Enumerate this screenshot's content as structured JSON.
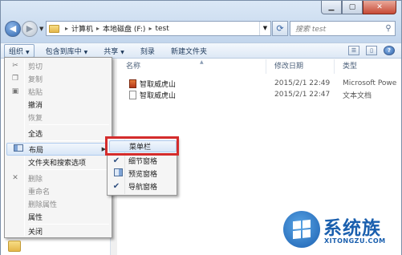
{
  "window": {
    "controls": {
      "minimize": "▁",
      "maximize": "▢",
      "close": "✕"
    }
  },
  "navigation": {
    "back_icon": "arrow-left-icon",
    "forward_icon": "arrow-right-icon",
    "breadcrumb": [
      "计算机",
      "本地磁盘 (F:)",
      "test"
    ],
    "search_placeholder": "搜索 test"
  },
  "toolbar": {
    "items": [
      {
        "label": "组织",
        "has_dropdown": true
      },
      {
        "label": "包含到库中",
        "has_dropdown": true
      },
      {
        "label": "共享",
        "has_dropdown": true
      },
      {
        "label": "刻录",
        "has_dropdown": false
      },
      {
        "label": "新建文件夹",
        "has_dropdown": false
      }
    ]
  },
  "file_list": {
    "columns": [
      "名称",
      "修改日期",
      "类型"
    ],
    "rows": [
      {
        "name": "智取威虎山",
        "modified": "2015/2/1 22:49",
        "type": "Microsoft Powe",
        "icon": "media-file-icon"
      },
      {
        "name": "智取威虎山",
        "modified": "2015/2/1 22:47",
        "type": "文本文档",
        "icon": "text-file-icon"
      }
    ]
  },
  "organize_menu": {
    "items": [
      {
        "label": "剪切",
        "enabled": false
      },
      {
        "label": "复制",
        "enabled": false
      },
      {
        "label": "粘贴",
        "enabled": false
      },
      {
        "label": "撤消",
        "enabled": true
      },
      {
        "label": "恢复",
        "enabled": false
      },
      {
        "label": "全选",
        "enabled": true
      },
      {
        "label": "布局",
        "enabled": true,
        "submenu": true
      },
      {
        "label": "文件夹和搜索选项",
        "enabled": true
      },
      {
        "label": "删除",
        "enabled": false
      },
      {
        "label": "重命名",
        "enabled": false
      },
      {
        "label": "删除属性",
        "enabled": false
      },
      {
        "label": "属性",
        "enabled": true
      },
      {
        "label": "关闭",
        "enabled": true
      }
    ]
  },
  "layout_submenu": {
    "items": [
      {
        "label": "菜单栏",
        "checked": false
      },
      {
        "label": "细节窗格",
        "checked": true
      },
      {
        "label": "预览窗格",
        "checked": false
      },
      {
        "label": "导航窗格",
        "checked": true
      }
    ]
  },
  "watermark": {
    "text": "系统族",
    "url": "XITONGZU.COM"
  },
  "colors": {
    "highlight_box": "#d42c2c",
    "accent": "#1a5fae"
  }
}
